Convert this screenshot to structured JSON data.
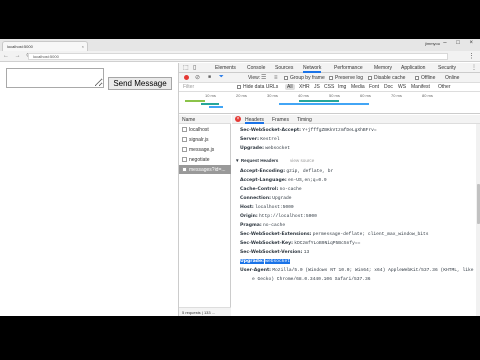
{
  "browser": {
    "tab_title": "localhost:5000",
    "tab_close": "×",
    "window_user": "jimmyou",
    "window_controls": "– □ ×",
    "nav_icons": "← → ⟳",
    "url": "localhost:5000",
    "menu_icon": "⋮"
  },
  "page": {
    "send_label": "Send Message"
  },
  "devtools": {
    "tabs": [
      "Elements",
      "Console",
      "Sources",
      "Network",
      "Performance",
      "Memory",
      "Application",
      "Security"
    ],
    "active_tab": "Network",
    "more": "⋮",
    "toolbar": {
      "view_label": "View:",
      "group_by_frame": "Group by frame",
      "preserve_log": "Preserve log",
      "disable_cache": "Disable cache",
      "offline": "Offline",
      "online": "Online"
    },
    "filterbar": {
      "filter_placeholder": "Filter",
      "hide_data_urls": "Hide data URLs",
      "types": [
        "All",
        "XHR",
        "JS",
        "CSS",
        "Img",
        "Media",
        "Font",
        "Doc",
        "WS",
        "Manifest",
        "Other"
      ],
      "active_type": "All"
    },
    "timeline_ticks": [
      "10 ms",
      "20 ms",
      "30 ms",
      "40 ms",
      "50 ms",
      "60 ms",
      "70 ms",
      "80 ms"
    ],
    "requests": {
      "header": "Name",
      "items": [
        "localhost",
        "signalr.js",
        "message.js",
        "negotiate",
        "messages?id=..."
      ],
      "selected_index": 4,
      "footer": "5 requests | 133 ..."
    },
    "detail": {
      "close_icon": "×",
      "tabs": [
        "Headers",
        "Frames",
        "Timing"
      ],
      "active_tab": "Headers",
      "response_headers": [
        {
          "name": "Sec-WebSocket-Accept:",
          "value": "Y+jfffgZBKkVtzmfDeLgXhBFrv="
        },
        {
          "name": "Server:",
          "value": "Kestrel"
        },
        {
          "name": "Upgrade:",
          "value": "websocket"
        }
      ],
      "request_headers_title": "▼ Request Headers",
      "view_source": "view source",
      "request_headers": [
        {
          "name": "Accept-Encoding:",
          "value": "gzip, deflate, br"
        },
        {
          "name": "Accept-Language:",
          "value": "en-US,en;q=0.9"
        },
        {
          "name": "Cache-Control:",
          "value": "no-cache"
        },
        {
          "name": "Connection:",
          "value": "Upgrade"
        },
        {
          "name": "Host:",
          "value": "localhost:5000"
        },
        {
          "name": "Origin:",
          "value": "http://localhost:5000"
        },
        {
          "name": "Pragma:",
          "value": "no-cache"
        },
        {
          "name": "Sec-WebSocket-Extensions:",
          "value": "permessage-deflate; client_max_window_bits"
        },
        {
          "name": "Sec-WebSocket-Key:",
          "value": "kDCzmfYLoB9NiqP5Bc5nfy=="
        },
        {
          "name": "Sec-WebSocket-Version:",
          "value": "13"
        },
        {
          "name": "Upgrade:",
          "value": "websocket"
        },
        {
          "name": "User-Agent:",
          "value": "Mozilla/5.0 (Windows NT 10.0; Win64; x64) AppleWebKit/537.36 (KHTML, like"
        },
        {
          "name": "",
          "value": "e Gecko) Chrome/68.0.3440.106 Safari/537.36"
        }
      ],
      "highlighted_row": 10
    }
  }
}
